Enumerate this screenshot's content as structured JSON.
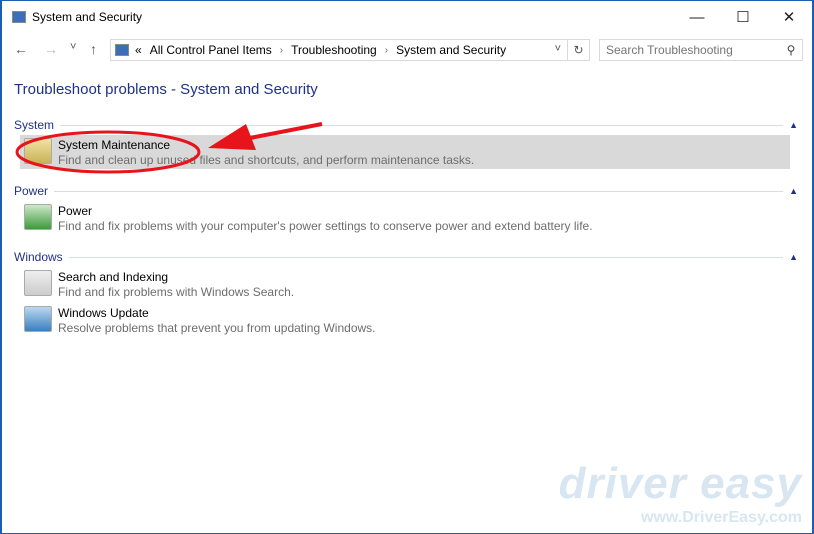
{
  "window": {
    "title": "System and Security",
    "minimize": "—",
    "maximize": "☐",
    "close": "✕"
  },
  "nav": {
    "back": "←",
    "forward": "→",
    "recent": "˅",
    "up": "↑"
  },
  "address": {
    "overflow": "«",
    "crumbs": [
      "All Control Panel Items",
      "Troubleshooting",
      "System and Security"
    ],
    "separator": "›",
    "dropdown": "˅",
    "refresh": "↻"
  },
  "search": {
    "placeholder": "Search Troubleshooting",
    "icon": "⚲"
  },
  "page_title": "Troubleshoot problems - System and Security",
  "groups": [
    {
      "label": "System",
      "items": [
        {
          "name": "System Maintenance",
          "desc": "Find and clean up unused files and shortcuts, and perform maintenance tasks.",
          "icon": "maintenance-icon",
          "selected": true
        }
      ]
    },
    {
      "label": "Power",
      "items": [
        {
          "name": "Power",
          "desc": "Find and fix problems with your computer's power settings to conserve power and extend battery life.",
          "icon": "power-icon"
        }
      ]
    },
    {
      "label": "Windows",
      "items": [
        {
          "name": "Search and Indexing",
          "desc": "Find and fix problems with Windows Search.",
          "icon": "search-indexing-icon"
        },
        {
          "name": "Windows Update",
          "desc": "Resolve problems that prevent you from updating Windows.",
          "icon": "windows-update-icon"
        }
      ]
    }
  ],
  "collapse_glyph": "▲",
  "annotation_color": "#e8141b",
  "watermark": {
    "brand": "driver easy",
    "url": "www.DriverEasy.com"
  }
}
